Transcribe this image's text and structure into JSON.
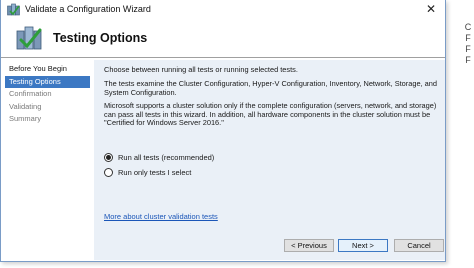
{
  "window": {
    "title": "Validate a Configuration Wizard",
    "close_glyph": "✕"
  },
  "header": {
    "title": "Testing Options",
    "icon": "cluster-validate-icon"
  },
  "nav": {
    "items": [
      {
        "label": "Before You Begin",
        "state": "done"
      },
      {
        "label": "Testing Options",
        "state": "active"
      },
      {
        "label": "Confirmation",
        "state": "todo"
      },
      {
        "label": "Validating",
        "state": "todo"
      },
      {
        "label": "Summary",
        "state": "todo"
      }
    ]
  },
  "content": {
    "intro": "Choose between running all tests or running selected tests.",
    "description": "The tests examine the Cluster Configuration, Hyper-V Configuration, Inventory, Network, Storage, and System Configuration.",
    "support_note": "Microsoft supports a cluster solution only if the complete configuration (servers, network, and storage) can pass all tests in this wizard. In addition, all hardware components in the cluster solution must be \"Certified for Windows Server 2016.\"",
    "options": [
      {
        "label": "Run all tests (recommended)",
        "selected": true
      },
      {
        "label": "Run only tests I select",
        "selected": false
      }
    ],
    "link": "More about cluster validation tests"
  },
  "buttons": {
    "previous": "< Previous",
    "next": "Next >",
    "cancel": "Cancel"
  },
  "behind_window": {
    "fragments": [
      "C",
      "F",
      "F",
      "F"
    ]
  },
  "colors": {
    "accent": "#3c78c3",
    "content_bg": "#eaf0f7",
    "link": "#1b56b8"
  }
}
